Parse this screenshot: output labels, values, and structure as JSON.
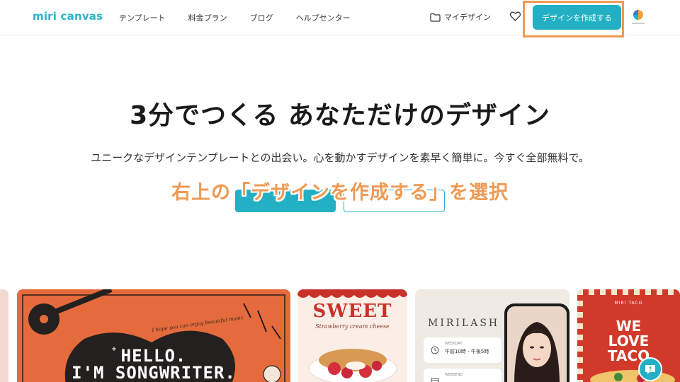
{
  "header": {
    "logo": "miri canvas",
    "nav": [
      "テンプレート",
      "料金プラン",
      "ブログ",
      "ヘルプセンター"
    ],
    "my_design": "マイデザイン",
    "create_button": "デザインを作成する"
  },
  "hero": {
    "title": "3分でつくる あなただけのデザイン",
    "subtitle": "ユニークなデザインテンプレートとの出会い。心を動かすデザインを素早く簡単に。今すぐ全部無料で。",
    "annotation": "右上の「デザインを作成する」を選択"
  },
  "cards": {
    "song": {
      "caption": "I hope you can enjoy beautiful music",
      "line1": "HELLO.",
      "line2": "I'M SONGWRITER."
    },
    "sweet": {
      "title": "SWEET",
      "subtitle": "Strawberry cream cheese"
    },
    "lash": {
      "title": "MIRILASH",
      "row1_label": "WEEKDAY",
      "row1_time": "午前10時 - 午後5時",
      "row2_label": "WEEKEND"
    },
    "taco": {
      "top": "MIRI TACO",
      "title_line1": "WE",
      "title_line2": "LOVE",
      "title_line3": "TACO"
    }
  },
  "colors": {
    "accent": "#24b0c4",
    "annotation": "#ef9a54"
  },
  "icons": {
    "folder": "folder-icon",
    "heart": "heart-icon",
    "help": "help-chat-icon"
  }
}
